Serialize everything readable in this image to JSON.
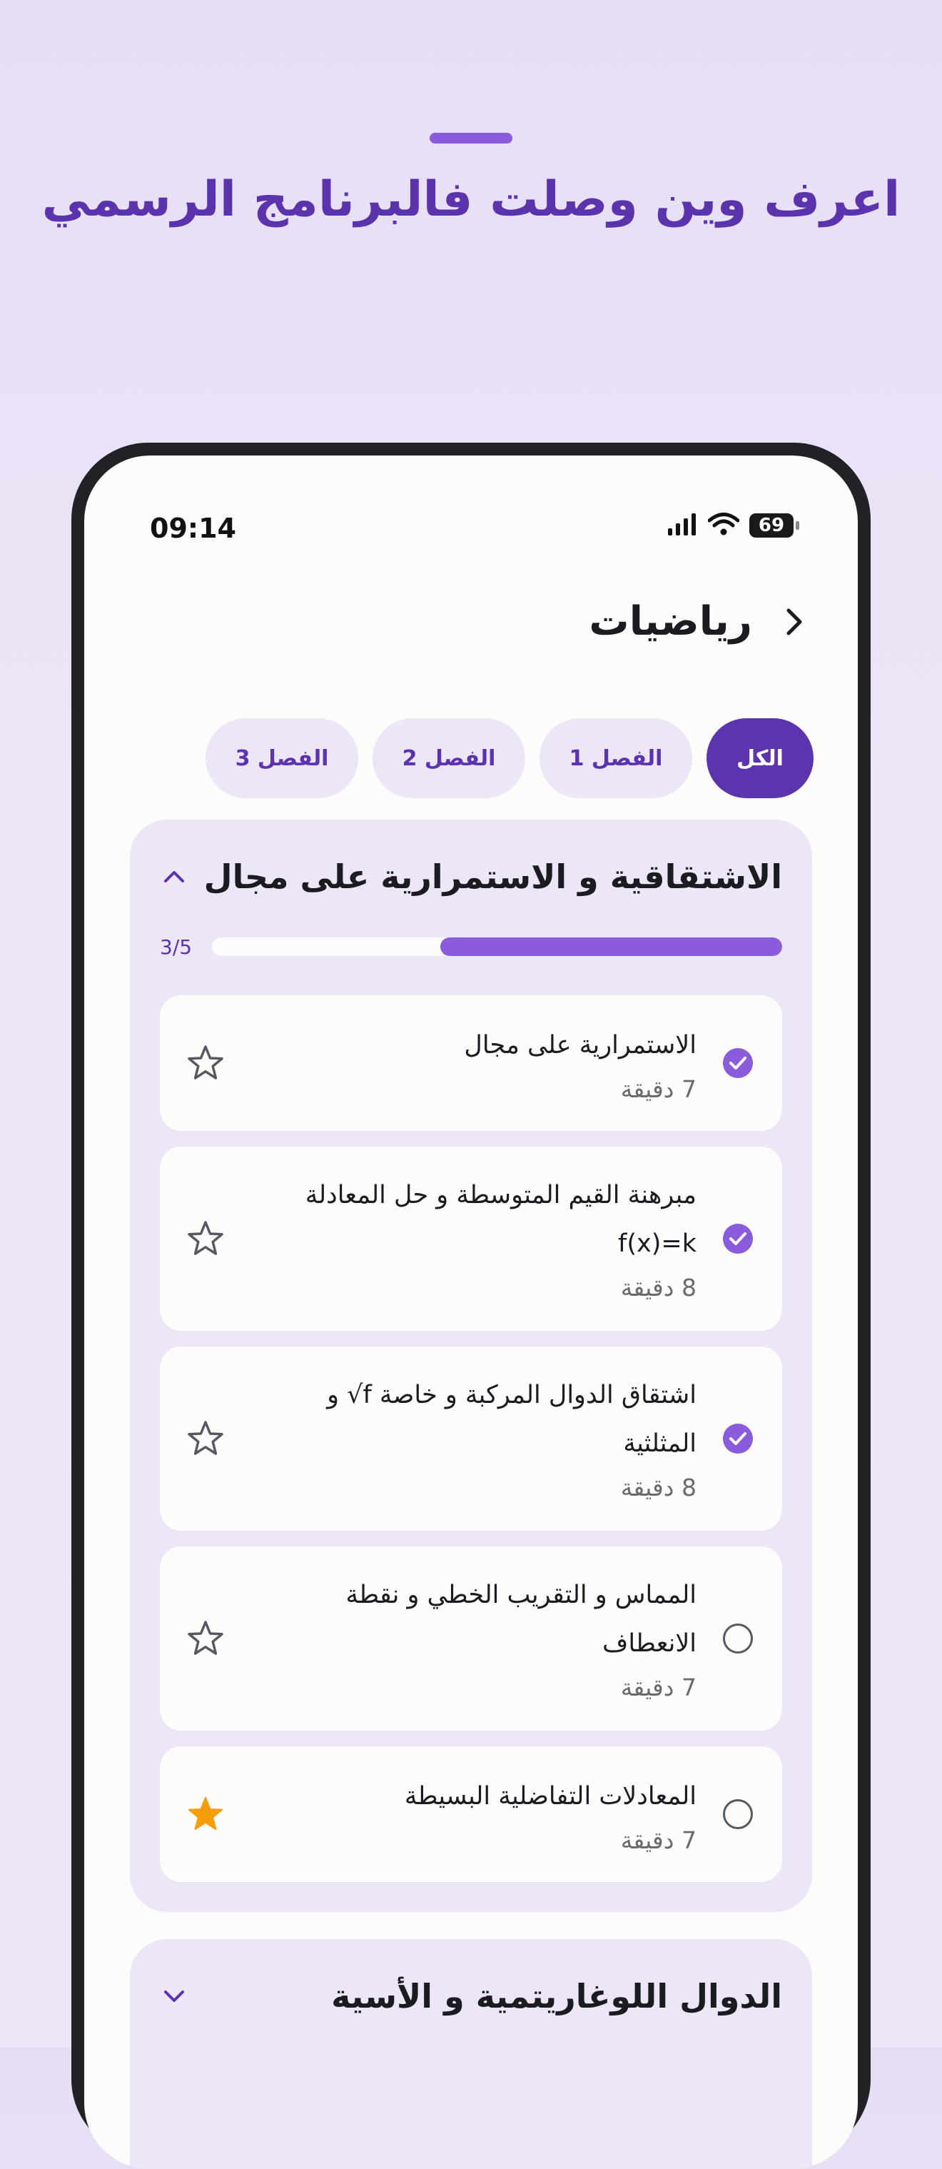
{
  "headline": "اعرف وين وصلت فالبرنامج الرسمي",
  "status_bar": {
    "time": "09:14",
    "battery": "69"
  },
  "page": {
    "title": "رياضيات"
  },
  "tabs": [
    {
      "label": "الكل",
      "active": true
    },
    {
      "label": "الفصل 1",
      "active": false
    },
    {
      "label": "الفصل 2",
      "active": false
    },
    {
      "label": "الفصل 3",
      "active": false
    }
  ],
  "section": {
    "title": "الاشتقاقية و الاستمرارية على مجال",
    "progress_text": "3/5",
    "progress_fraction": 0.6,
    "lessons": [
      {
        "title": "الاستمرارية على مجال",
        "duration": "7 دقيقة",
        "completed": true,
        "starred": false
      },
      {
        "title": "مبرهنة القيم المتوسطة و حل المعادلة f(x)=k",
        "duration": "8 دقيقة",
        "completed": true,
        "starred": false
      },
      {
        "title": "اشتقاق الدوال المركبة و خاصة f√ و المثلثية",
        "duration": "8 دقيقة",
        "completed": true,
        "starred": false
      },
      {
        "title": "المماس و التقريب الخطي و نقطة الانعطاف",
        "duration": "7 دقيقة",
        "completed": false,
        "starred": false
      },
      {
        "title": "المعادلات التفاضلية البسيطة",
        "duration": "7 دقيقة",
        "completed": false,
        "starred": true
      }
    ]
  },
  "section2": {
    "title": "الدوال اللوغاريتمية و الأسية"
  },
  "colors": {
    "accent": "#5b35ae",
    "accent_light": "#8a5cdb",
    "star_filled": "#f59e0b",
    "card_bg": "#ece6f7"
  }
}
